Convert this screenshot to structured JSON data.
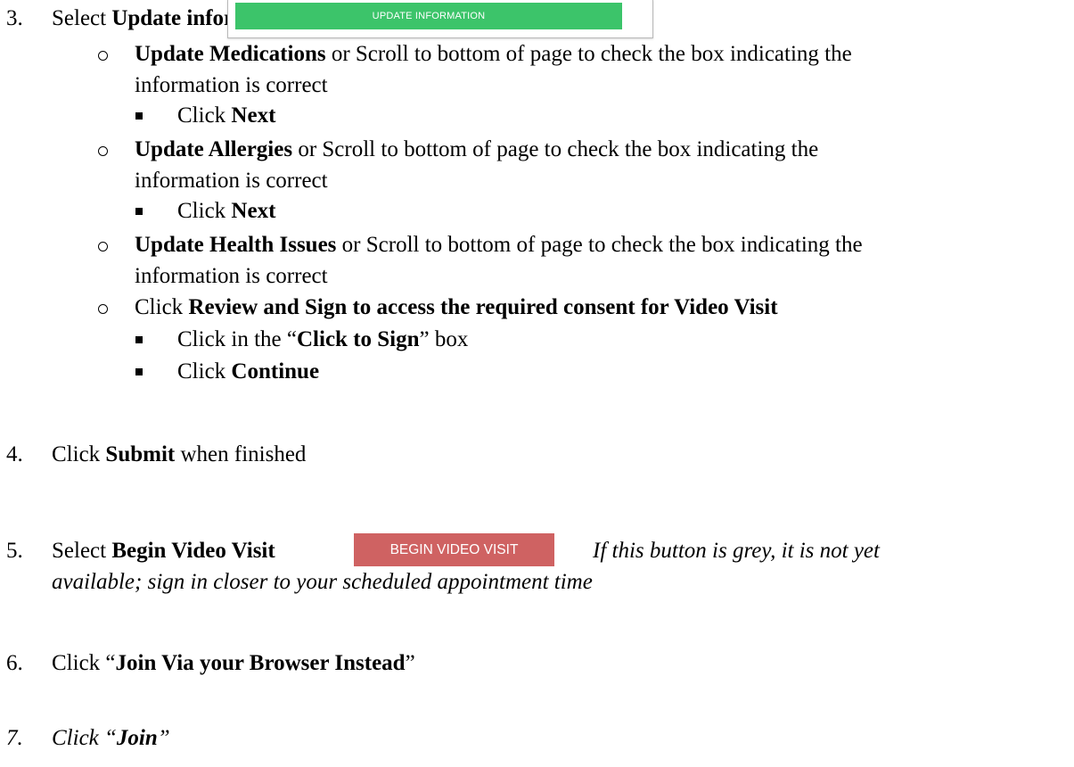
{
  "step3": {
    "number": "3.",
    "select": "Select",
    "bold": "Update information",
    "button_label": "UPDATE INFORMATION",
    "medications": {
      "bold": "Update Medications",
      "rest1": " or Scroll to bottom of page to check the box indicating the",
      "rest2": "information is correct",
      "click": "Click",
      "click_bold": "Next"
    },
    "allergies": {
      "bold": "Update Allergies",
      "rest1": " or Scroll to bottom of page to check the box indicating the",
      "rest2": "information is correct",
      "click": "Click",
      "click_bold": "Next"
    },
    "health": {
      "bold": "Update Health Issues",
      "rest1": " or Scroll to bottom of page to check the box indicating the",
      "rest2": "information is correct"
    },
    "review": {
      "click": "Click",
      "bold": "Review and Sign to access the required consent for Video Visit",
      "sign_pre": "Click in the “",
      "sign_bold": "Click to Sign",
      "sign_post": "” box",
      "continue_pre": "Click",
      "continue_bold": "Continue"
    }
  },
  "step4": {
    "number": "4.",
    "pre": "Click",
    "bold": "Submit",
    "post": " when finished"
  },
  "step5": {
    "number": "5.",
    "select": "Select",
    "bold": "Begin Video Visit",
    "button_label": "BEGIN VIDEO VISIT",
    "note1": "If this button is grey, it is not yet",
    "note2": "available; sign in closer to your scheduled appointment time"
  },
  "step6": {
    "number": "6.",
    "pre": "Click “",
    "bold": "Join Via your Browser Instead",
    "post": "”"
  },
  "step7": {
    "number": "7.",
    "pre": "Click “",
    "bold": "Join",
    "post": "”"
  },
  "colors": {
    "update_button": "#3cc46a",
    "begin_button": "#cf6262"
  }
}
